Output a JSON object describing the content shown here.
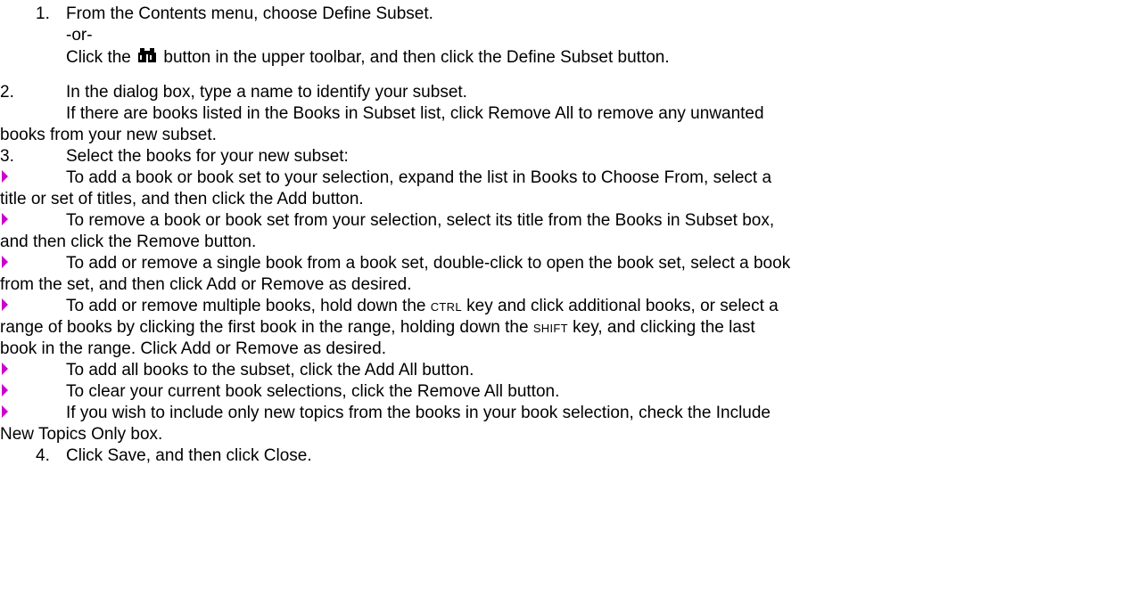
{
  "steps": {
    "step1": {
      "number": "1.",
      "text": "From the Contents menu, choose Define Subset.",
      "or": "-or-",
      "alt_before": "Click the",
      "alt_icon": "binoculars-find-icon",
      "alt_after": "button in the upper toolbar, and then click the Define Subset button."
    },
    "step2": {
      "number": "2.",
      "text": "In the dialog box, type a name to identify your subset.",
      "note_line1": "If there are books listed in the Books in Subset list, click Remove All to remove any unwanted",
      "note_line2": "books from your new subset."
    },
    "step3": {
      "number": "3.",
      "text": "Select the books for your new subset:",
      "bullets": [
        {
          "line1": "To add a book or book set to your selection, expand the list in Books to Choose From, select a",
          "line2": "title or set of titles, and then click the Add button."
        },
        {
          "line1": "To remove a book or book set from your selection, select its title from the Books in Subset box,",
          "line2": "and then click the Remove button."
        },
        {
          "line1": "To add or remove a single book from a book set, double-click to open the book set, select a book",
          "line2": "from the set, and then click Add or Remove as desired."
        },
        {
          "line1_a": "To add or remove multiple books, hold down the",
          "key1": "CTRL",
          "line1_b": "key and click additional books, or select a",
          "line2_a": "range of books by clicking the first book in the range, holding down the",
          "key2": "SHIFT",
          "line2_b": "key, and clicking the last",
          "line3": "book in the range. Click Add or Remove as desired."
        },
        {
          "line1": "To add all books to the subset, click the Add All button."
        },
        {
          "line1": "To clear your current book selections, click the Remove All button."
        },
        {
          "line1": "If you wish to include only new topics from the books in your book selection, check the Include",
          "line2": "New Topics Only box."
        }
      ],
      "bullet_color": "#cc00cc"
    },
    "step4": {
      "number": "4.",
      "text": "Click Save, and then click Close."
    }
  }
}
